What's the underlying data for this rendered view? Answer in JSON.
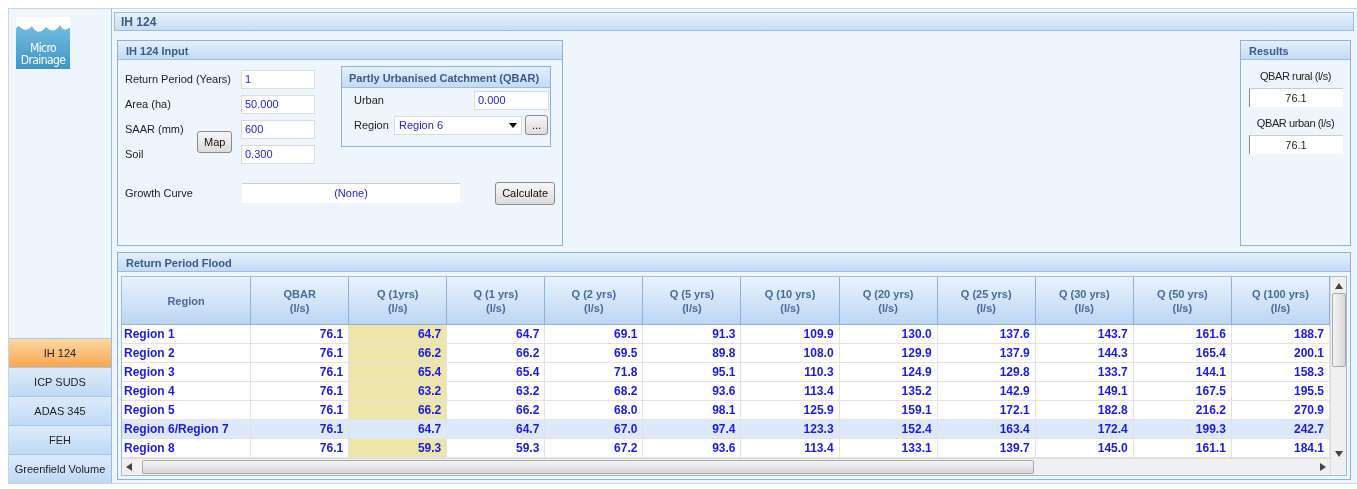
{
  "logo": {
    "line1": "Micro",
    "line2": "Drainage"
  },
  "sidebar": {
    "items": [
      {
        "label": "IH 124",
        "selected": true
      },
      {
        "label": "ICP SUDS",
        "selected": false
      },
      {
        "label": "ADAS 345",
        "selected": false
      },
      {
        "label": "FEH",
        "selected": false
      },
      {
        "label": "Greenfield Volume",
        "selected": false
      }
    ]
  },
  "page_title": "IH 124",
  "input_panel": {
    "title": "IH 124 Input",
    "fields": [
      {
        "label": "Return Period (Years)",
        "value": "1"
      },
      {
        "label": "Area (ha)",
        "value": "50.000"
      },
      {
        "label": "SAAR (mm)",
        "value": "600"
      },
      {
        "label": "Soil",
        "value": "0.300"
      }
    ],
    "map_button": "Map",
    "growth_curve": {
      "label": "Growth Curve",
      "value": "(None)"
    },
    "calculate_button": "Calculate",
    "qbar_group": {
      "title": "Partly Urbanised Catchment (QBAR)",
      "urban_label": "Urban",
      "urban_value": "0.000",
      "region_label": "Region",
      "region_value": "Region 6",
      "browse_button": "..."
    }
  },
  "results": {
    "title": "Results",
    "items": [
      {
        "label": "QBAR rural (l/s)",
        "value": "76.1"
      },
      {
        "label": "QBAR urban (l/s)",
        "value": "76.1"
      }
    ]
  },
  "flood_table": {
    "title": "Return Period Flood",
    "columns": [
      {
        "line1": "Region",
        "highlighted": false
      },
      {
        "line1": "QBAR",
        "line2": "(l/s)",
        "highlighted": false
      },
      {
        "line1": "Q (1yrs)",
        "line2": "(l/s)",
        "highlighted": true
      },
      {
        "line1": "Q (1 yrs)",
        "line2": "(l/s)",
        "highlighted": false
      },
      {
        "line1": "Q (2 yrs)",
        "line2": "(l/s)",
        "highlighted": false
      },
      {
        "line1": "Q (5 yrs)",
        "line2": "(l/s)",
        "highlighted": false
      },
      {
        "line1": "Q (10 yrs)",
        "line2": "(l/s)",
        "highlighted": false
      },
      {
        "line1": "Q (20 yrs)",
        "line2": "(l/s)",
        "highlighted": false
      },
      {
        "line1": "Q (25 yrs)",
        "line2": "(l/s)",
        "highlighted": false
      },
      {
        "line1": "Q (30 yrs)",
        "line2": "(l/s)",
        "highlighted": false
      },
      {
        "line1": "Q (50 yrs)",
        "line2": "(l/s)",
        "highlighted": false
      },
      {
        "line1": "Q (100 yrs)",
        "line2": "(l/s)",
        "highlighted": false
      }
    ],
    "rows": [
      {
        "selected": false,
        "cells": [
          "Region 1",
          "76.1",
          "64.7",
          "64.7",
          "69.1",
          "91.3",
          "109.9",
          "130.0",
          "137.6",
          "143.7",
          "161.6",
          "188.7"
        ]
      },
      {
        "selected": false,
        "cells": [
          "Region 2",
          "76.1",
          "66.2",
          "66.2",
          "69.5",
          "89.8",
          "108.0",
          "129.9",
          "137.9",
          "144.3",
          "165.4",
          "200.1"
        ]
      },
      {
        "selected": false,
        "cells": [
          "Region 3",
          "76.1",
          "65.4",
          "65.4",
          "71.8",
          "95.1",
          "110.3",
          "124.9",
          "129.8",
          "133.7",
          "144.1",
          "158.3"
        ]
      },
      {
        "selected": false,
        "cells": [
          "Region 4",
          "76.1",
          "63.2",
          "63.2",
          "68.2",
          "93.6",
          "113.4",
          "135.2",
          "142.9",
          "149.1",
          "167.5",
          "195.5"
        ]
      },
      {
        "selected": false,
        "cells": [
          "Region 5",
          "76.1",
          "66.2",
          "66.2",
          "68.0",
          "98.1",
          "125.9",
          "159.1",
          "172.1",
          "182.8",
          "216.2",
          "270.9"
        ]
      },
      {
        "selected": true,
        "cells": [
          "Region 6/Region 7",
          "76.1",
          "64.7",
          "64.7",
          "67.0",
          "97.4",
          "123.3",
          "152.4",
          "163.4",
          "172.4",
          "199.3",
          "242.7"
        ]
      },
      {
        "selected": false,
        "cells": [
          "Region 8",
          "76.1",
          "59.3",
          "59.3",
          "67.2",
          "93.6",
          "113.4",
          "133.1",
          "139.7",
          "145.0",
          "161.1",
          "184.1"
        ]
      }
    ]
  }
}
